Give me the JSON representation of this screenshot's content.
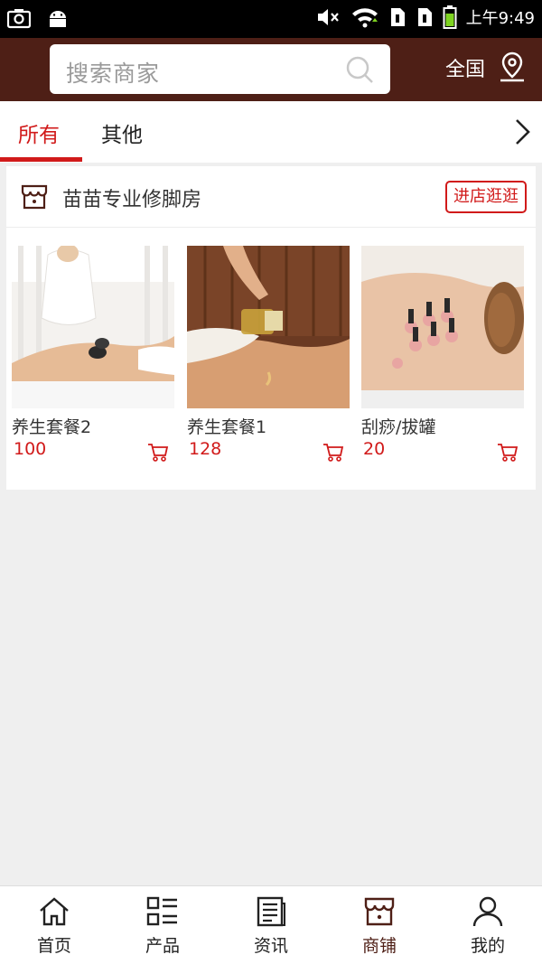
{
  "status_bar": {
    "time": "上午9:49",
    "icons": [
      "camera-icon",
      "android-icon",
      "mute-icon",
      "wifi-icon",
      "sim1-icon",
      "sim2-icon",
      "battery-icon"
    ]
  },
  "header": {
    "search_placeholder": "搜索商家",
    "region_label": "全国",
    "brand_color": "#4e1f16"
  },
  "tabs": {
    "items": [
      {
        "label": "所有",
        "active": true
      },
      {
        "label": "其他",
        "active": false
      }
    ],
    "accent_color": "#d11a1a"
  },
  "store": {
    "name": "苗苗专业修脚房",
    "enter_label": "进店逛逛",
    "products": [
      {
        "name": "养生套餐2",
        "price": "100"
      },
      {
        "name": "养生套餐1",
        "price": "128"
      },
      {
        "name": "刮痧/拔罐",
        "price": "20"
      }
    ]
  },
  "bottom_nav": {
    "items": [
      {
        "label": "首页",
        "icon": "home-icon"
      },
      {
        "label": "产品",
        "icon": "grid-list-icon"
      },
      {
        "label": "资讯",
        "icon": "news-icon"
      },
      {
        "label": "商铺",
        "icon": "store-icon",
        "active": true
      },
      {
        "label": "我的",
        "icon": "user-icon"
      }
    ]
  }
}
